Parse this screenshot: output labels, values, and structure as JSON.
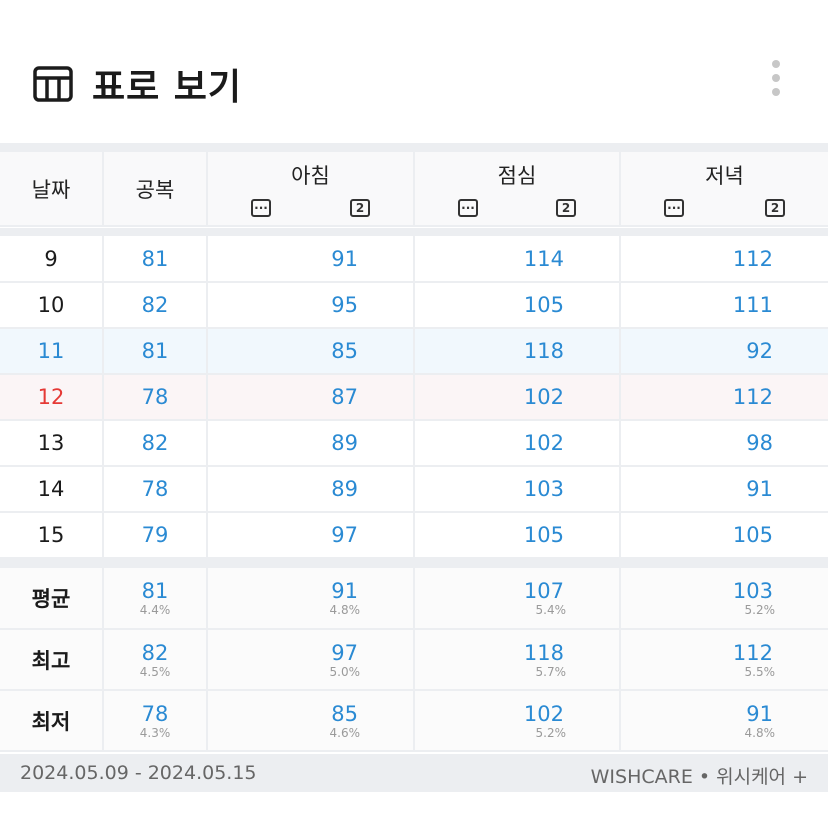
{
  "header": {
    "title": "표로 보기",
    "icon": "table-icon"
  },
  "columns": {
    "date": "날짜",
    "fasting": "공복",
    "meals": [
      {
        "name": "아침",
        "before_icon": "before-meal-icon",
        "after_icon": "after-2h-icon",
        "after_glyph": "2"
      },
      {
        "name": "점심",
        "before_icon": "before-meal-icon",
        "after_icon": "after-2h-icon",
        "after_glyph": "2"
      },
      {
        "name": "저녁",
        "before_icon": "before-meal-icon",
        "after_icon": "after-2h-icon",
        "after_glyph": "2"
      }
    ]
  },
  "rows": [
    {
      "date": "9",
      "fasting": "81",
      "breakfast": "91",
      "lunch": "114",
      "dinner": "112"
    },
    {
      "date": "10",
      "fasting": "82",
      "breakfast": "95",
      "lunch": "105",
      "dinner": "111"
    },
    {
      "date": "11",
      "fasting": "81",
      "breakfast": "85",
      "lunch": "118",
      "dinner": "92"
    },
    {
      "date": "12",
      "fasting": "78",
      "breakfast": "87",
      "lunch": "102",
      "dinner": "112"
    },
    {
      "date": "13",
      "fasting": "82",
      "breakfast": "89",
      "lunch": "102",
      "dinner": "98"
    },
    {
      "date": "14",
      "fasting": "78",
      "breakfast": "89",
      "lunch": "103",
      "dinner": "91"
    },
    {
      "date": "15",
      "fasting": "79",
      "breakfast": "97",
      "lunch": "105",
      "dinner": "105"
    }
  ],
  "stats": [
    {
      "label": "평균",
      "fasting": {
        "value": "81",
        "pct": "4.4%"
      },
      "breakfast": {
        "value": "91",
        "pct": "4.8%"
      },
      "lunch": {
        "value": "107",
        "pct": "5.4%"
      },
      "dinner": {
        "value": "103",
        "pct": "5.2%"
      }
    },
    {
      "label": "최고",
      "fasting": {
        "value": "82",
        "pct": "4.5%"
      },
      "breakfast": {
        "value": "97",
        "pct": "5.0%"
      },
      "lunch": {
        "value": "118",
        "pct": "5.7%"
      },
      "dinner": {
        "value": "112",
        "pct": "5.5%"
      }
    },
    {
      "label": "최저",
      "fasting": {
        "value": "78",
        "pct": "4.3%"
      },
      "breakfast": {
        "value": "85",
        "pct": "4.6%"
      },
      "lunch": {
        "value": "102",
        "pct": "5.2%"
      },
      "dinner": {
        "value": "91",
        "pct": "4.8%"
      }
    }
  ],
  "footer": {
    "date_range": "2024.05.09 - 2024.05.15",
    "brand": "WISHCARE • 위시케어 +"
  },
  "colors": {
    "value": "#2a8ad3",
    "sunday_date": "#e53935",
    "highlight_saturday": "#f1f8fd",
    "highlight_sunday": "#fbf5f6"
  }
}
